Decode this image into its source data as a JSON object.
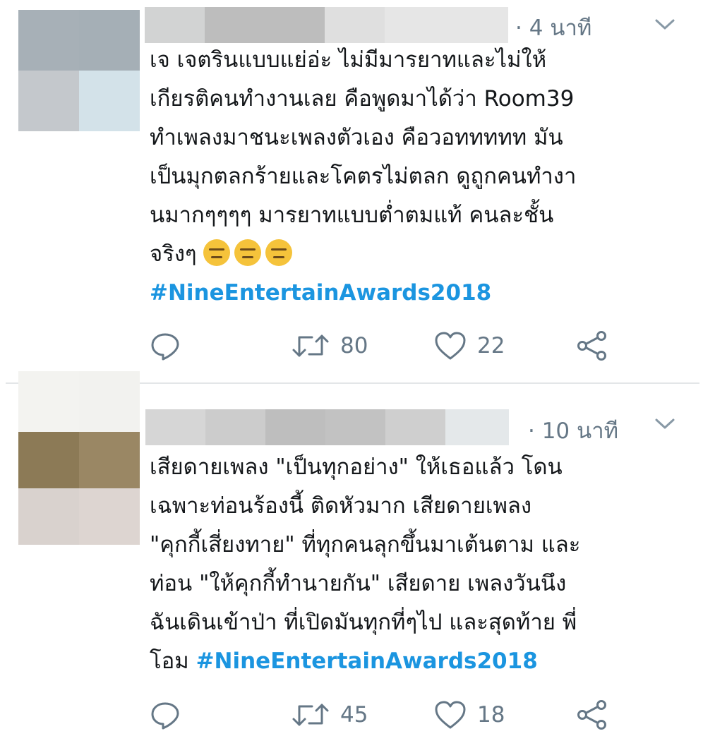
{
  "tweets": [
    {
      "time": "· 4 นาที",
      "text_lines": [
        "เจ เจตรินแบบแย่อ่ะ ไม่มีมารยาทและไม่ให้",
        "เกียรติคนทำงานเลย คือพูดมาได้ว่า Room39",
        "ทำเพลงมาชนะเพลงตัวเอง คือวอททททท มัน",
        "เป็นมุกตลกร้ายและโคตรไม่ตลก ดูถูกคนทำงา",
        "นมากๆๆๆๆ มารยาทแบบต่ำตมแท้ คนละชั้น",
        "จริงๆ"
      ],
      "emoji": [
        "expressionless-face",
        "expressionless-face",
        "expressionless-face"
      ],
      "hashtag": "#NineEntertainAwards2018",
      "retweets": "80",
      "likes": "22"
    },
    {
      "time": "· 10 นาที",
      "text_lines": [
        "เสียดายเพลง \"เป็นทุกอย่าง\" ให้เธอแล้ว โดน",
        "เฉพาะท่อนร้องนี้ ติดหัวมาก เสียดายเพลง",
        "\"คุกกี้เสี่ยงทาย\" ที่ทุกคนลุกขึ้นมาเต้นตาม และ",
        "ท่อน \"ให้คุกกี้ทำนายกัน\" เสียดาย เพลงวันนึง",
        "ฉันเดินเข้าป่า ที่เปิดมันทุกที่ๆไป และสุดท้าย พี่",
        "โอม "
      ],
      "hashtag": "#NineEntertainAwards2018",
      "retweets": "45",
      "likes": "18"
    }
  ],
  "colors": {
    "hashtag": "#1b95e0",
    "meta_gray": "#657786",
    "text": "#14171a",
    "avatar1": [
      "#a7b0b7",
      "#a5afb6",
      "#c4c8cc",
      "#d3e2e9"
    ],
    "avatar2": [
      "#f3f3f0",
      "#f2f2ef",
      "#8c7a56",
      "#9a8764",
      "#d9d2ce",
      "#ddd5d1"
    ],
    "name_blur1": [
      "#d2d3d3",
      "#bdbdbd",
      "#bbbbbb",
      "#dfdfdf",
      "#e6e6e6"
    ],
    "name_blur2": [
      "#d6d6d6",
      "#cccccc",
      "#bebebe",
      "#c2c2c2",
      "#cfcfcf",
      "#e4e8ea"
    ]
  },
  "icons": [
    "reply-icon",
    "retweet-icon",
    "like-icon",
    "share-icon",
    "chevron-down-icon"
  ]
}
